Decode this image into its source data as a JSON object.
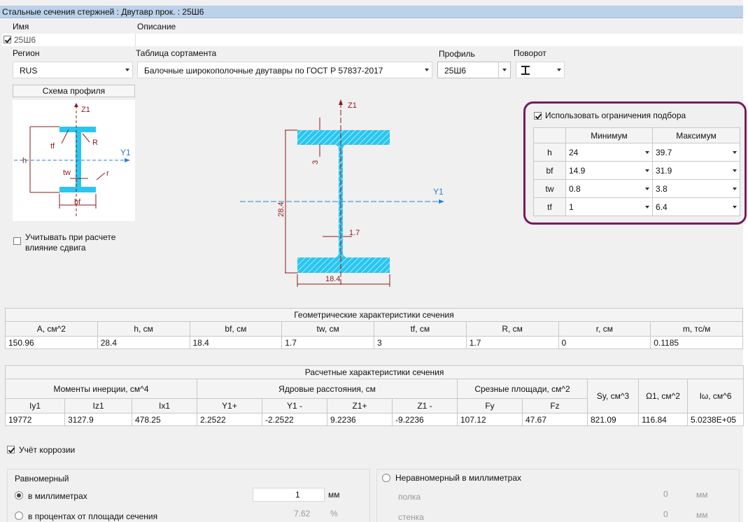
{
  "window": {
    "title": "Стальные сечения стержней : Двутавр прок. : 25Ш6"
  },
  "name_label": "Имя",
  "name_value": "25Ш6",
  "description_label": "Описание",
  "region": {
    "label": "Регион",
    "value": "RUS"
  },
  "table": {
    "label": "Таблица сортамента",
    "value": "Балочные широкополочные двутавры по ГОСТ Р 57837-2017"
  },
  "profile": {
    "label": "Профиль",
    "value": "25Ш6"
  },
  "rotation": {
    "label": "Поворот",
    "icon": "i-beam-icon"
  },
  "scheme": {
    "header": "Схема профиля",
    "labels": {
      "z1": "Z1",
      "y1": "Y1",
      "tf": "tf",
      "R": "R",
      "h": "h",
      "tw": "tw",
      "r": "r",
      "bf": "bf"
    }
  },
  "shear_checkbox": {
    "line1": "Учитывать при расчете",
    "line2": "влияние сдвига",
    "checked": false
  },
  "drawing": {
    "z1": "Z1",
    "y1": "Y1",
    "h": "28.4",
    "bf": "18.4",
    "tf": "3",
    "tw": "1.7",
    "hatch_color": "#29c6f0",
    "dim_color": "#8b1a1a"
  },
  "constraints": {
    "checkbox_label": "Использовать ограничения подбора",
    "checked": true,
    "min_header": "Минимум",
    "max_header": "Максимум",
    "rows": [
      {
        "param": "h",
        "min": "24",
        "max": "39.7"
      },
      {
        "param": "bf",
        "min": "14.9",
        "max": "31.9"
      },
      {
        "param": "tw",
        "min": "0.8",
        "max": "3.8"
      },
      {
        "param": "tf",
        "min": "1",
        "max": "6.4"
      }
    ],
    "highlight_color": "#7a1a5c"
  },
  "geom": {
    "title": "Геометрические характеристики сечения",
    "headers": [
      "A, см^2",
      "h, см",
      "bf, см",
      "tw, см",
      "tf, см",
      "R, см",
      "r, см",
      "m, тс/м"
    ],
    "values": [
      "150.96",
      "28.4",
      "18.4",
      "1.7",
      "3",
      "1.7",
      "0",
      "0.1185"
    ]
  },
  "calc": {
    "title": "Расчетные характеристики сечения",
    "groups": [
      "Моменты инерции, см^4",
      "Ядровые расстояния, см",
      "Срезные площади, см^2",
      "Sy, см^3",
      "Ω1, см^2",
      "Iω, см^6"
    ],
    "subheaders": [
      "Iy1",
      "Iz1",
      "Ix1",
      "Y1+",
      "Y1 -",
      "Z1+",
      "Z1 -",
      "Fy",
      "Fz"
    ],
    "values": [
      "19772",
      "3127.9",
      "478.25",
      "2.2522",
      "-2.2522",
      "9.2236",
      "-9.2236",
      "107.12",
      "47.67",
      "821.09",
      "116.84",
      "5.0238E+05"
    ]
  },
  "corrosion": {
    "label": "Учёт коррозии",
    "checked": true,
    "uniform": {
      "title": "Равномерный",
      "mm_label": "в миллиметрах",
      "mm_value": "1",
      "mm_unit": "мм",
      "pct_label": "в процентах от площади сечения",
      "pct_value": "7.62",
      "pct_unit": "%"
    },
    "nonuniform": {
      "title": "Неравномерный в миллиметрах",
      "flange_label": "полка",
      "flange_value": "0",
      "flange_unit": "мм",
      "web_label": "стенка",
      "web_value": "0",
      "web_unit": "мм"
    }
  }
}
